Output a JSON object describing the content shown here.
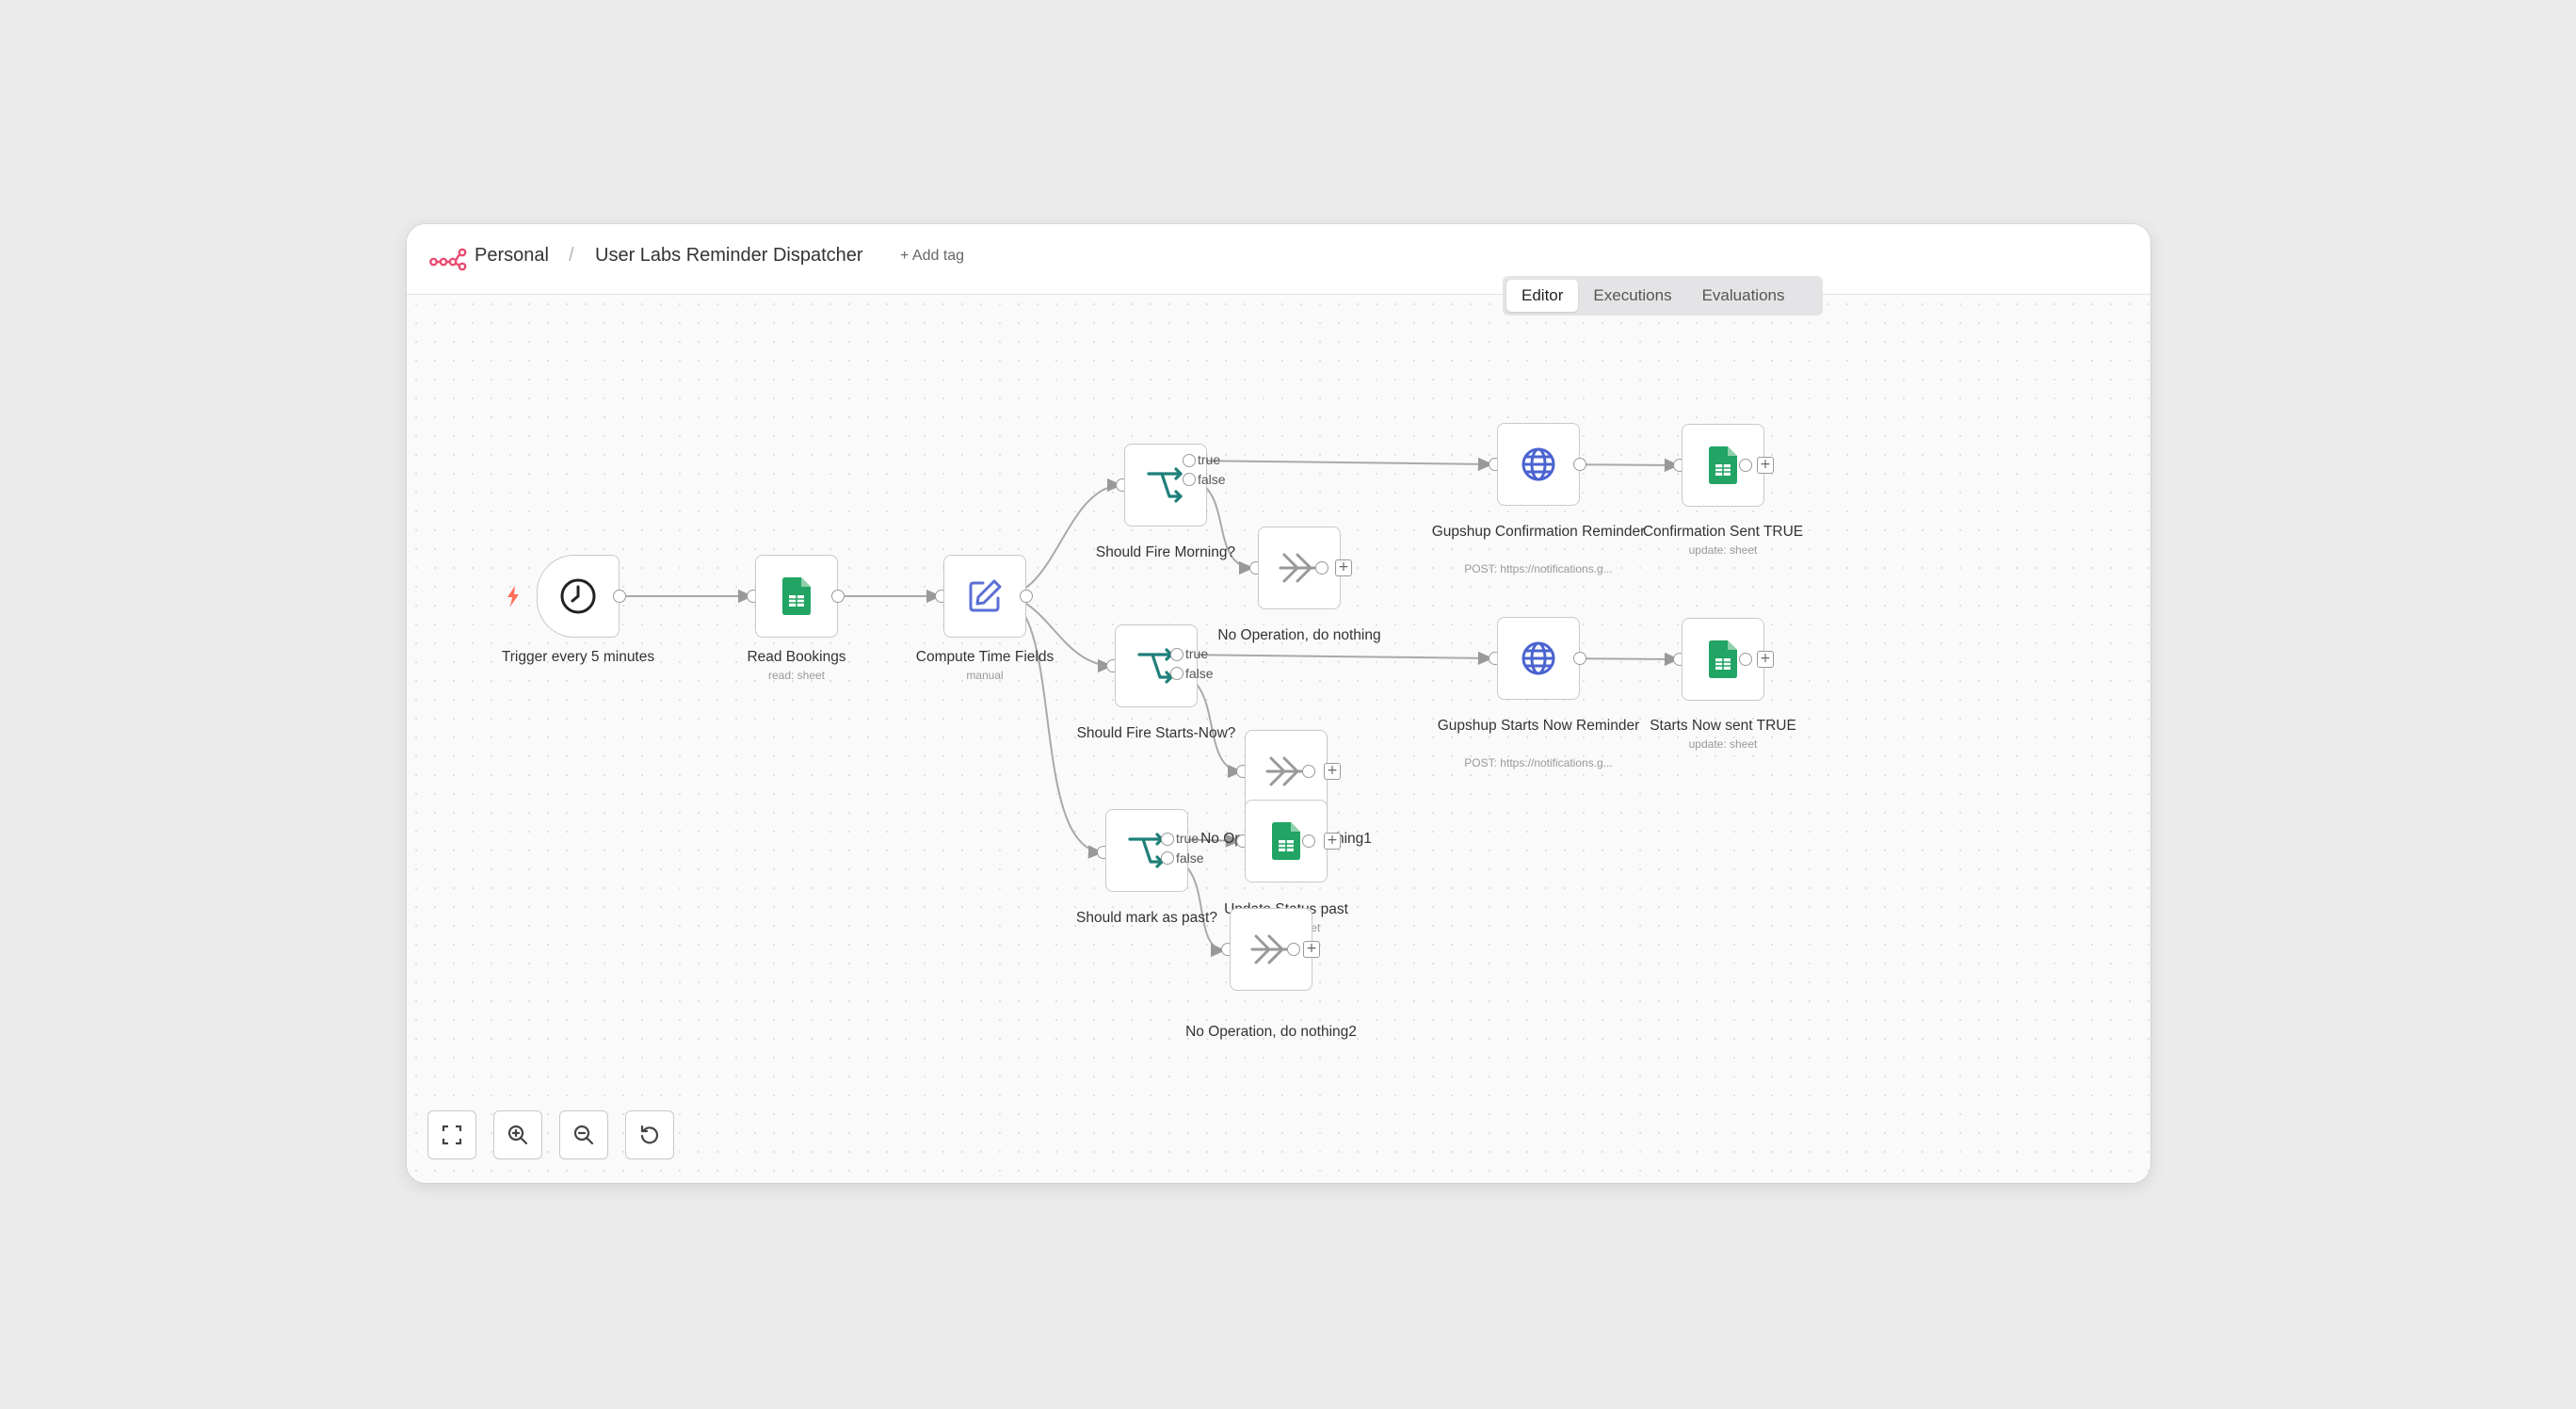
{
  "header": {
    "workspace": "Personal",
    "separator": "/",
    "workflow_name": "User Labs Reminder Dispatcher",
    "add_tag": "+ Add tag"
  },
  "tabs": [
    "Editor",
    "Executions",
    "Evaluations"
  ],
  "active_tab": "Editor",
  "nodes": {
    "trigger": {
      "label": "Trigger every 5 minutes",
      "sub": "",
      "icon": "clock-icon"
    },
    "read_bookings": {
      "label": "Read Bookings",
      "sub": "read: sheet",
      "icon": "google-sheets-icon"
    },
    "compute_time": {
      "label": "Compute Time Fields",
      "sub": "manual",
      "icon": "edit-icon"
    },
    "if_morning": {
      "label": "Should Fire Morning?",
      "sub": "",
      "icon": "if-branch-icon"
    },
    "noop": {
      "label": "No Operation, do nothing",
      "sub": "",
      "icon": "noop-icon"
    },
    "gupshup_confirm": {
      "label": "Gupshup Confirmation Reminder",
      "sub": "POST: https://notifications.g...",
      "icon": "globe-icon"
    },
    "confirm_sent": {
      "label": "Confirmation Sent TRUE",
      "sub": "update: sheet",
      "icon": "google-sheets-icon"
    },
    "if_starts": {
      "label": "Should Fire Starts-Now?",
      "sub": "",
      "icon": "if-branch-icon"
    },
    "noop1": {
      "label": "No Operation, do nothing1",
      "sub": "",
      "icon": "noop-icon"
    },
    "gupshup_starts": {
      "label": "Gupshup Starts Now Reminder",
      "sub": "POST: https://notifications.g...",
      "icon": "globe-icon"
    },
    "starts_sent": {
      "label": "Starts Now sent TRUE",
      "sub": "update: sheet",
      "icon": "google-sheets-icon"
    },
    "if_past": {
      "label": "Should mark as past?",
      "sub": "",
      "icon": "if-branch-icon"
    },
    "update_past": {
      "label": "Update Status past",
      "sub": "update: sheet",
      "icon": "google-sheets-icon"
    },
    "noop2": {
      "label": "No Operation, do nothing2",
      "sub": "",
      "icon": "noop-icon"
    }
  },
  "branch_labels": {
    "true": "true",
    "false": "false"
  },
  "controls": [
    "fit-view-icon",
    "zoom-in-icon",
    "zoom-out-icon",
    "reset-zoom-icon"
  ],
  "colors": {
    "logo": "#ea4b71",
    "trigger_bolt": "#ff6d5a",
    "sheets_green": "#21a464",
    "edit_blue": "#5b6fd6",
    "globe_blue": "#4a63d0",
    "if_teal": "#1f7f79"
  }
}
